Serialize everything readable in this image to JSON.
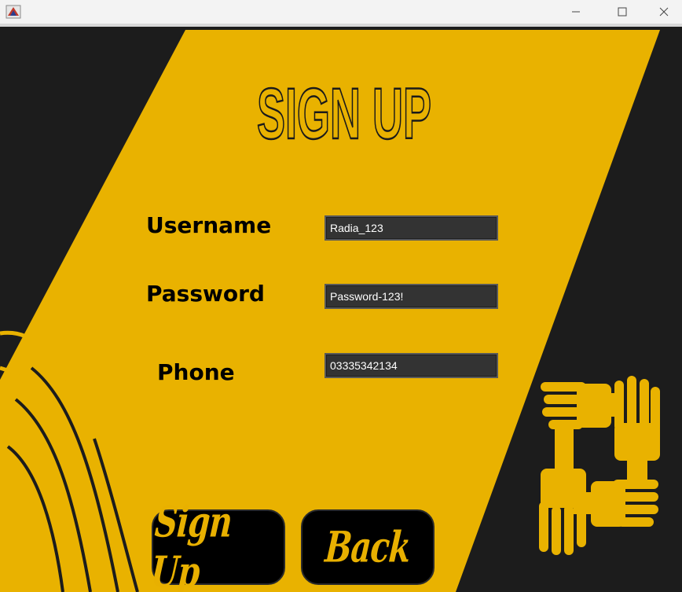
{
  "window": {
    "controls": {
      "minimize": "minimize",
      "maximize": "maximize",
      "close": "close"
    }
  },
  "page": {
    "title": "SIGN UP"
  },
  "form": {
    "username_label": "Username",
    "username_value": "Radia_123",
    "password_label": "Password",
    "password_value": "Password-123!",
    "phone_label": "Phone",
    "phone_value": "03335342134"
  },
  "buttons": {
    "signup_label": "Sign Up",
    "back_label": "Back"
  },
  "colors": {
    "accent": "#e9b200",
    "background": "#1c1c1c",
    "field": "#333333"
  },
  "icons": [
    "app-icon",
    "minimize-icon",
    "maximize-icon",
    "close-icon",
    "wavy-lines-decoration",
    "joined-hands-icon"
  ]
}
